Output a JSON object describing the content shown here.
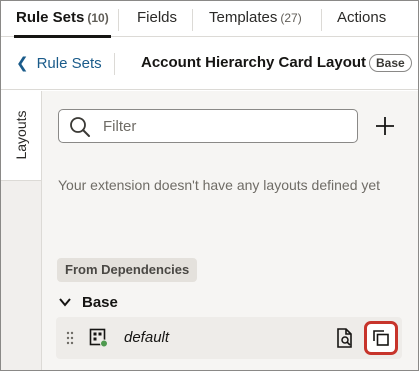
{
  "tabs": [
    {
      "label": "Rule Sets",
      "count": "(10)",
      "active": true
    },
    {
      "label": "Fields",
      "count": ""
    },
    {
      "label": "Templates",
      "count": "(27)"
    },
    {
      "label": "Actions",
      "count": ""
    }
  ],
  "header": {
    "back_label": "Rule Sets",
    "title": "Account Hierarchy Card Layout",
    "badge": "Base"
  },
  "side_tab": {
    "label": "Layouts"
  },
  "search": {
    "placeholder": "Filter",
    "value": ""
  },
  "empty_message": "Your extension doesn't have any layouts defined yet",
  "dependencies": {
    "label": "From Dependencies",
    "group": {
      "name": "Base",
      "expanded": true,
      "items": [
        {
          "name": "default",
          "status_color": "#4e9a4f"
        }
      ]
    }
  },
  "colors": {
    "link": "#1a5b8a",
    "highlight": "#c7342b"
  },
  "icons": {
    "back": "chevron-left-icon",
    "search": "search-icon",
    "add": "plus-icon",
    "group_caret": "chevron-down-icon",
    "drag": "drag-handle-icon",
    "layout": "layout-grid-icon",
    "preview": "document-search-icon",
    "duplicate": "duplicate-icon"
  }
}
